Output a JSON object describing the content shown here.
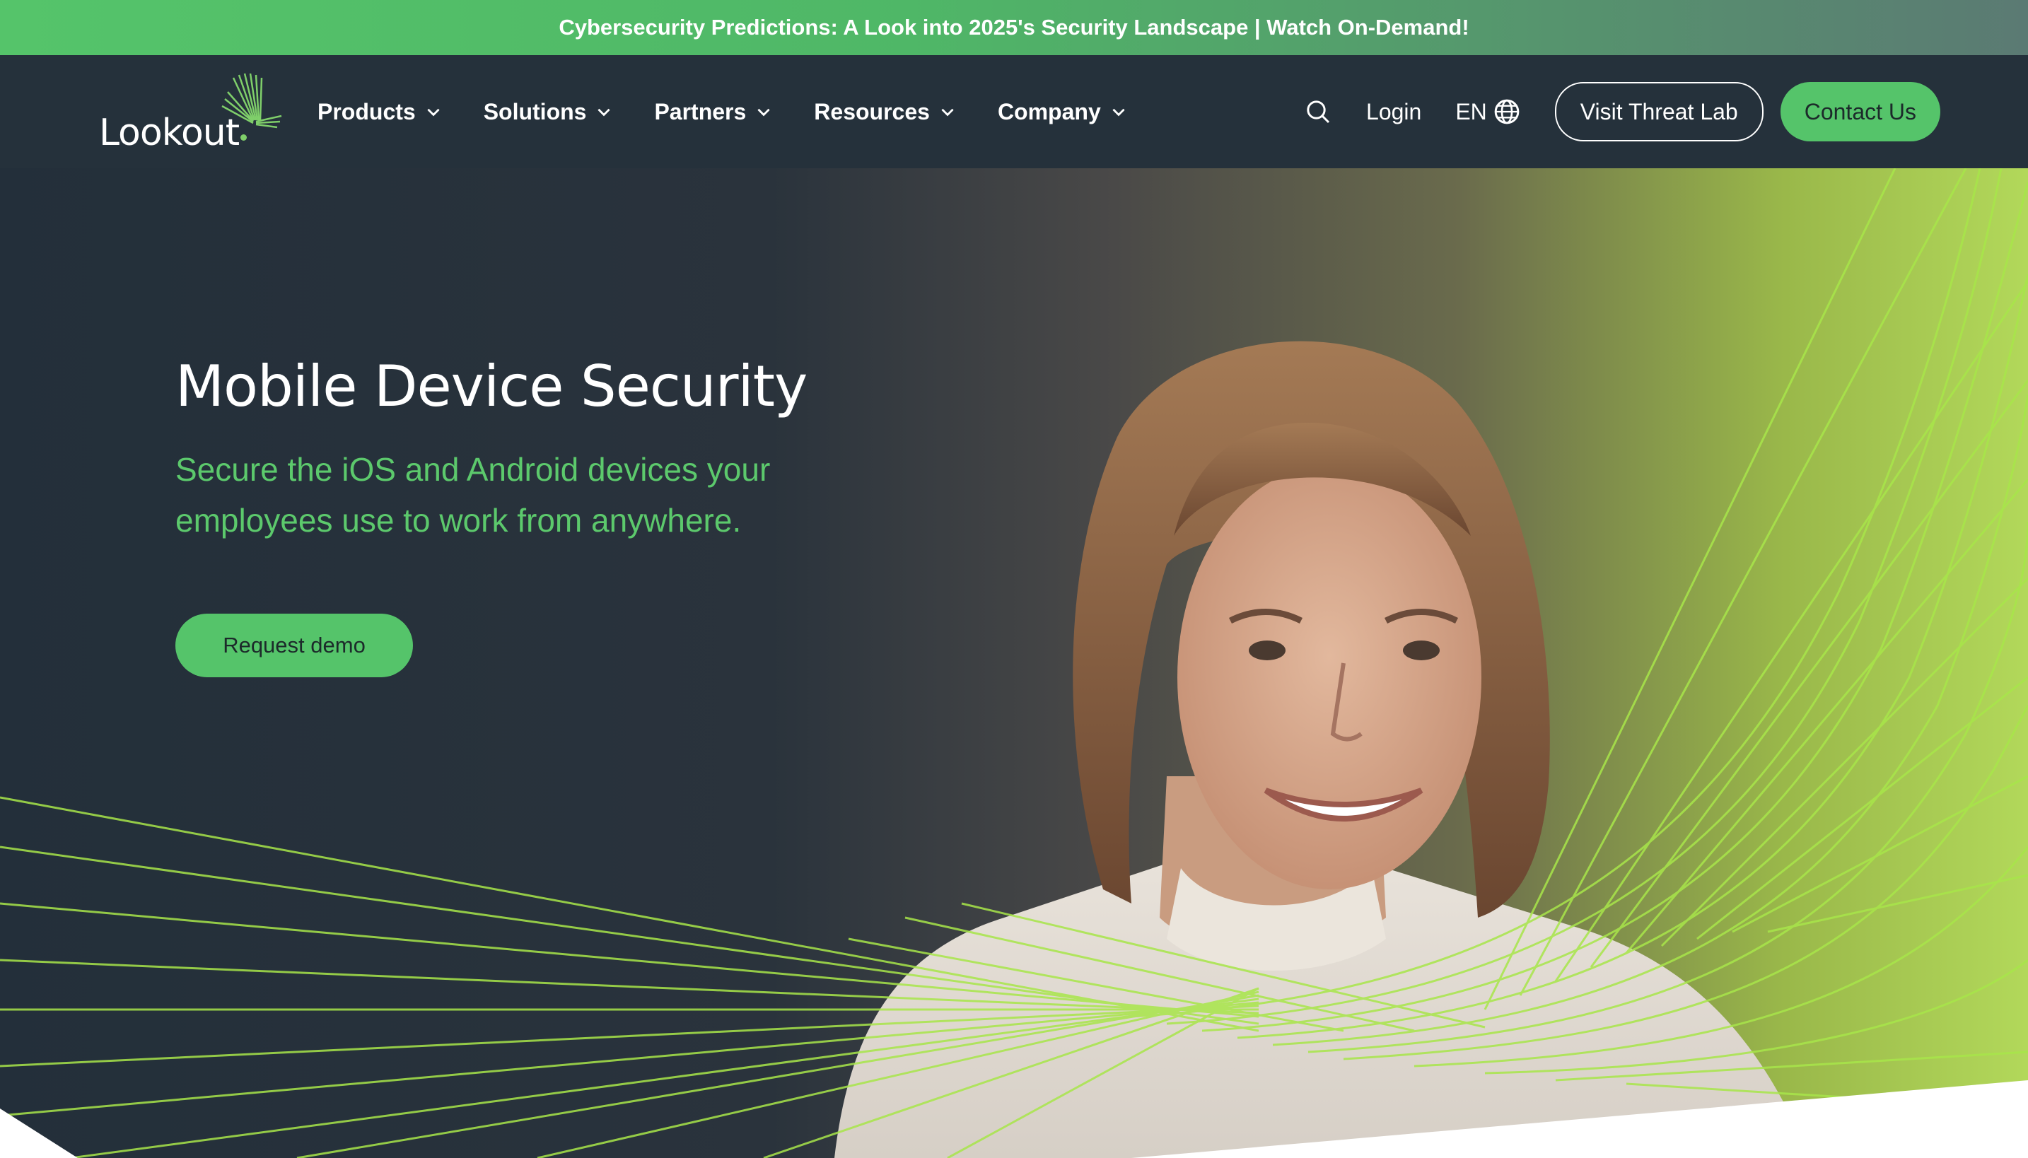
{
  "banner": {
    "text": "Cybersecurity Predictions: A Look into 2025's Security Landscape | Watch On-Demand!"
  },
  "brand": {
    "logo_text": "Lookout",
    "logo_icon": "lookout-fan-mark"
  },
  "nav": {
    "items": [
      {
        "label": "Products"
      },
      {
        "label": "Solutions"
      },
      {
        "label": "Partners"
      },
      {
        "label": "Resources"
      },
      {
        "label": "Company"
      }
    ],
    "search_icon": "search-icon",
    "login_label": "Login",
    "language": "EN",
    "language_icon": "globe-icon",
    "threat_lab_label": "Visit Threat Lab",
    "contact_label": "Contact Us"
  },
  "hero": {
    "title": "Mobile Device Security",
    "subtitle": "Secure the iOS and Android devices your employees use to work from anywhere.",
    "cta_label": "Request demo"
  },
  "colors": {
    "brand_green": "#55c46a",
    "nav_bg": "#25313b",
    "lime_accent": "#a8e64a"
  }
}
